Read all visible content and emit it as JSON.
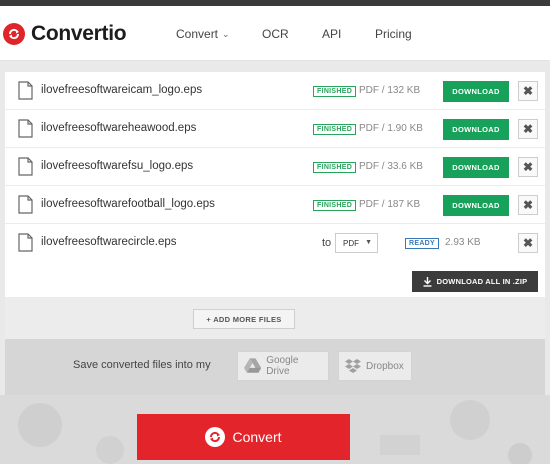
{
  "brand": {
    "name": "Convertio",
    "accent": "#e0252a"
  },
  "nav": {
    "convert": "Convert",
    "ocr": "OCR",
    "api": "API",
    "pricing": "Pricing"
  },
  "files": [
    {
      "name": "ilovefreesoftwareicam_logo.eps",
      "status": "FINISHED",
      "size": "PDF / 132 KB",
      "action": "DOWNLOAD"
    },
    {
      "name": "ilovefreesoftwareheawood.eps",
      "status": "FINISHED",
      "size": "PDF / 1.90 KB",
      "action": "DOWNLOAD"
    },
    {
      "name": "ilovefreesoftwarefsu_logo.eps",
      "status": "FINISHED",
      "size": "PDF / 33.6 KB",
      "action": "DOWNLOAD"
    },
    {
      "name": "ilovefreesoftwarefootball_logo.eps",
      "status": "FINISHED",
      "size": "PDF / 187 KB",
      "action": "DOWNLOAD"
    }
  ],
  "pending_file": {
    "name": "ilovefreesoftwarecircle.eps",
    "to_label": "to",
    "format": "PDF",
    "status": "READY",
    "size": "2.93 KB"
  },
  "actions": {
    "download_all": "DOWNLOAD ALL IN .ZIP",
    "add_more": "+ ADD MORE FILES",
    "convert": "Convert"
  },
  "save": {
    "label": "Save converted files into my",
    "google_drive": "Google Drive",
    "dropbox": "Dropbox"
  },
  "colors": {
    "download_green": "#18a15a",
    "convert_red": "#e3242b",
    "ready_blue": "#3a78b5"
  }
}
